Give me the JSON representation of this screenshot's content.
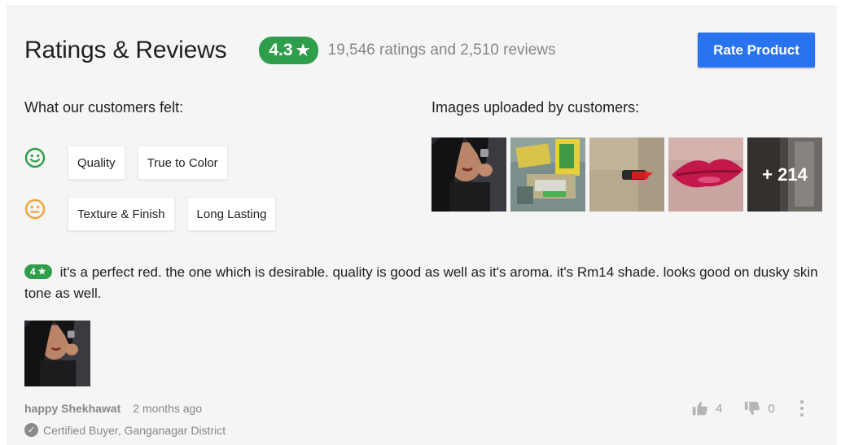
{
  "header": {
    "title": "Ratings & Reviews",
    "rating": "4.3",
    "star_icon": "star-icon",
    "summary": "19,546 ratings and 2,510 reviews",
    "rate_button": "Rate Product"
  },
  "sentiment": {
    "title": "What our customers felt:",
    "positive": {
      "icon": "smile-face-icon",
      "color": "#2e9e4b",
      "chips": [
        "Quality",
        "True to Color"
      ]
    },
    "neutral": {
      "icon": "neutral-face-icon",
      "color": "#f0a43a",
      "chips": [
        "Texture & Finish",
        "Long Lasting"
      ]
    }
  },
  "customer_images": {
    "title": "Images uploaded by customers:",
    "more_count": "+ 214"
  },
  "review": {
    "rating": "4",
    "text": "it's a perfect red. the one which is desirable. quality is good as well as it's aroma. it's Rm14 shade. looks good on dusky skin tone as well.",
    "author": "happy Shekhawat",
    "time": "2 months ago",
    "certified": "Certified Buyer, Ganganagar District",
    "likes": "4",
    "dislikes": "0"
  },
  "colors": {
    "accent_green": "#2e9e4b",
    "button_blue": "#2874f0",
    "muted_text": "#878787"
  }
}
